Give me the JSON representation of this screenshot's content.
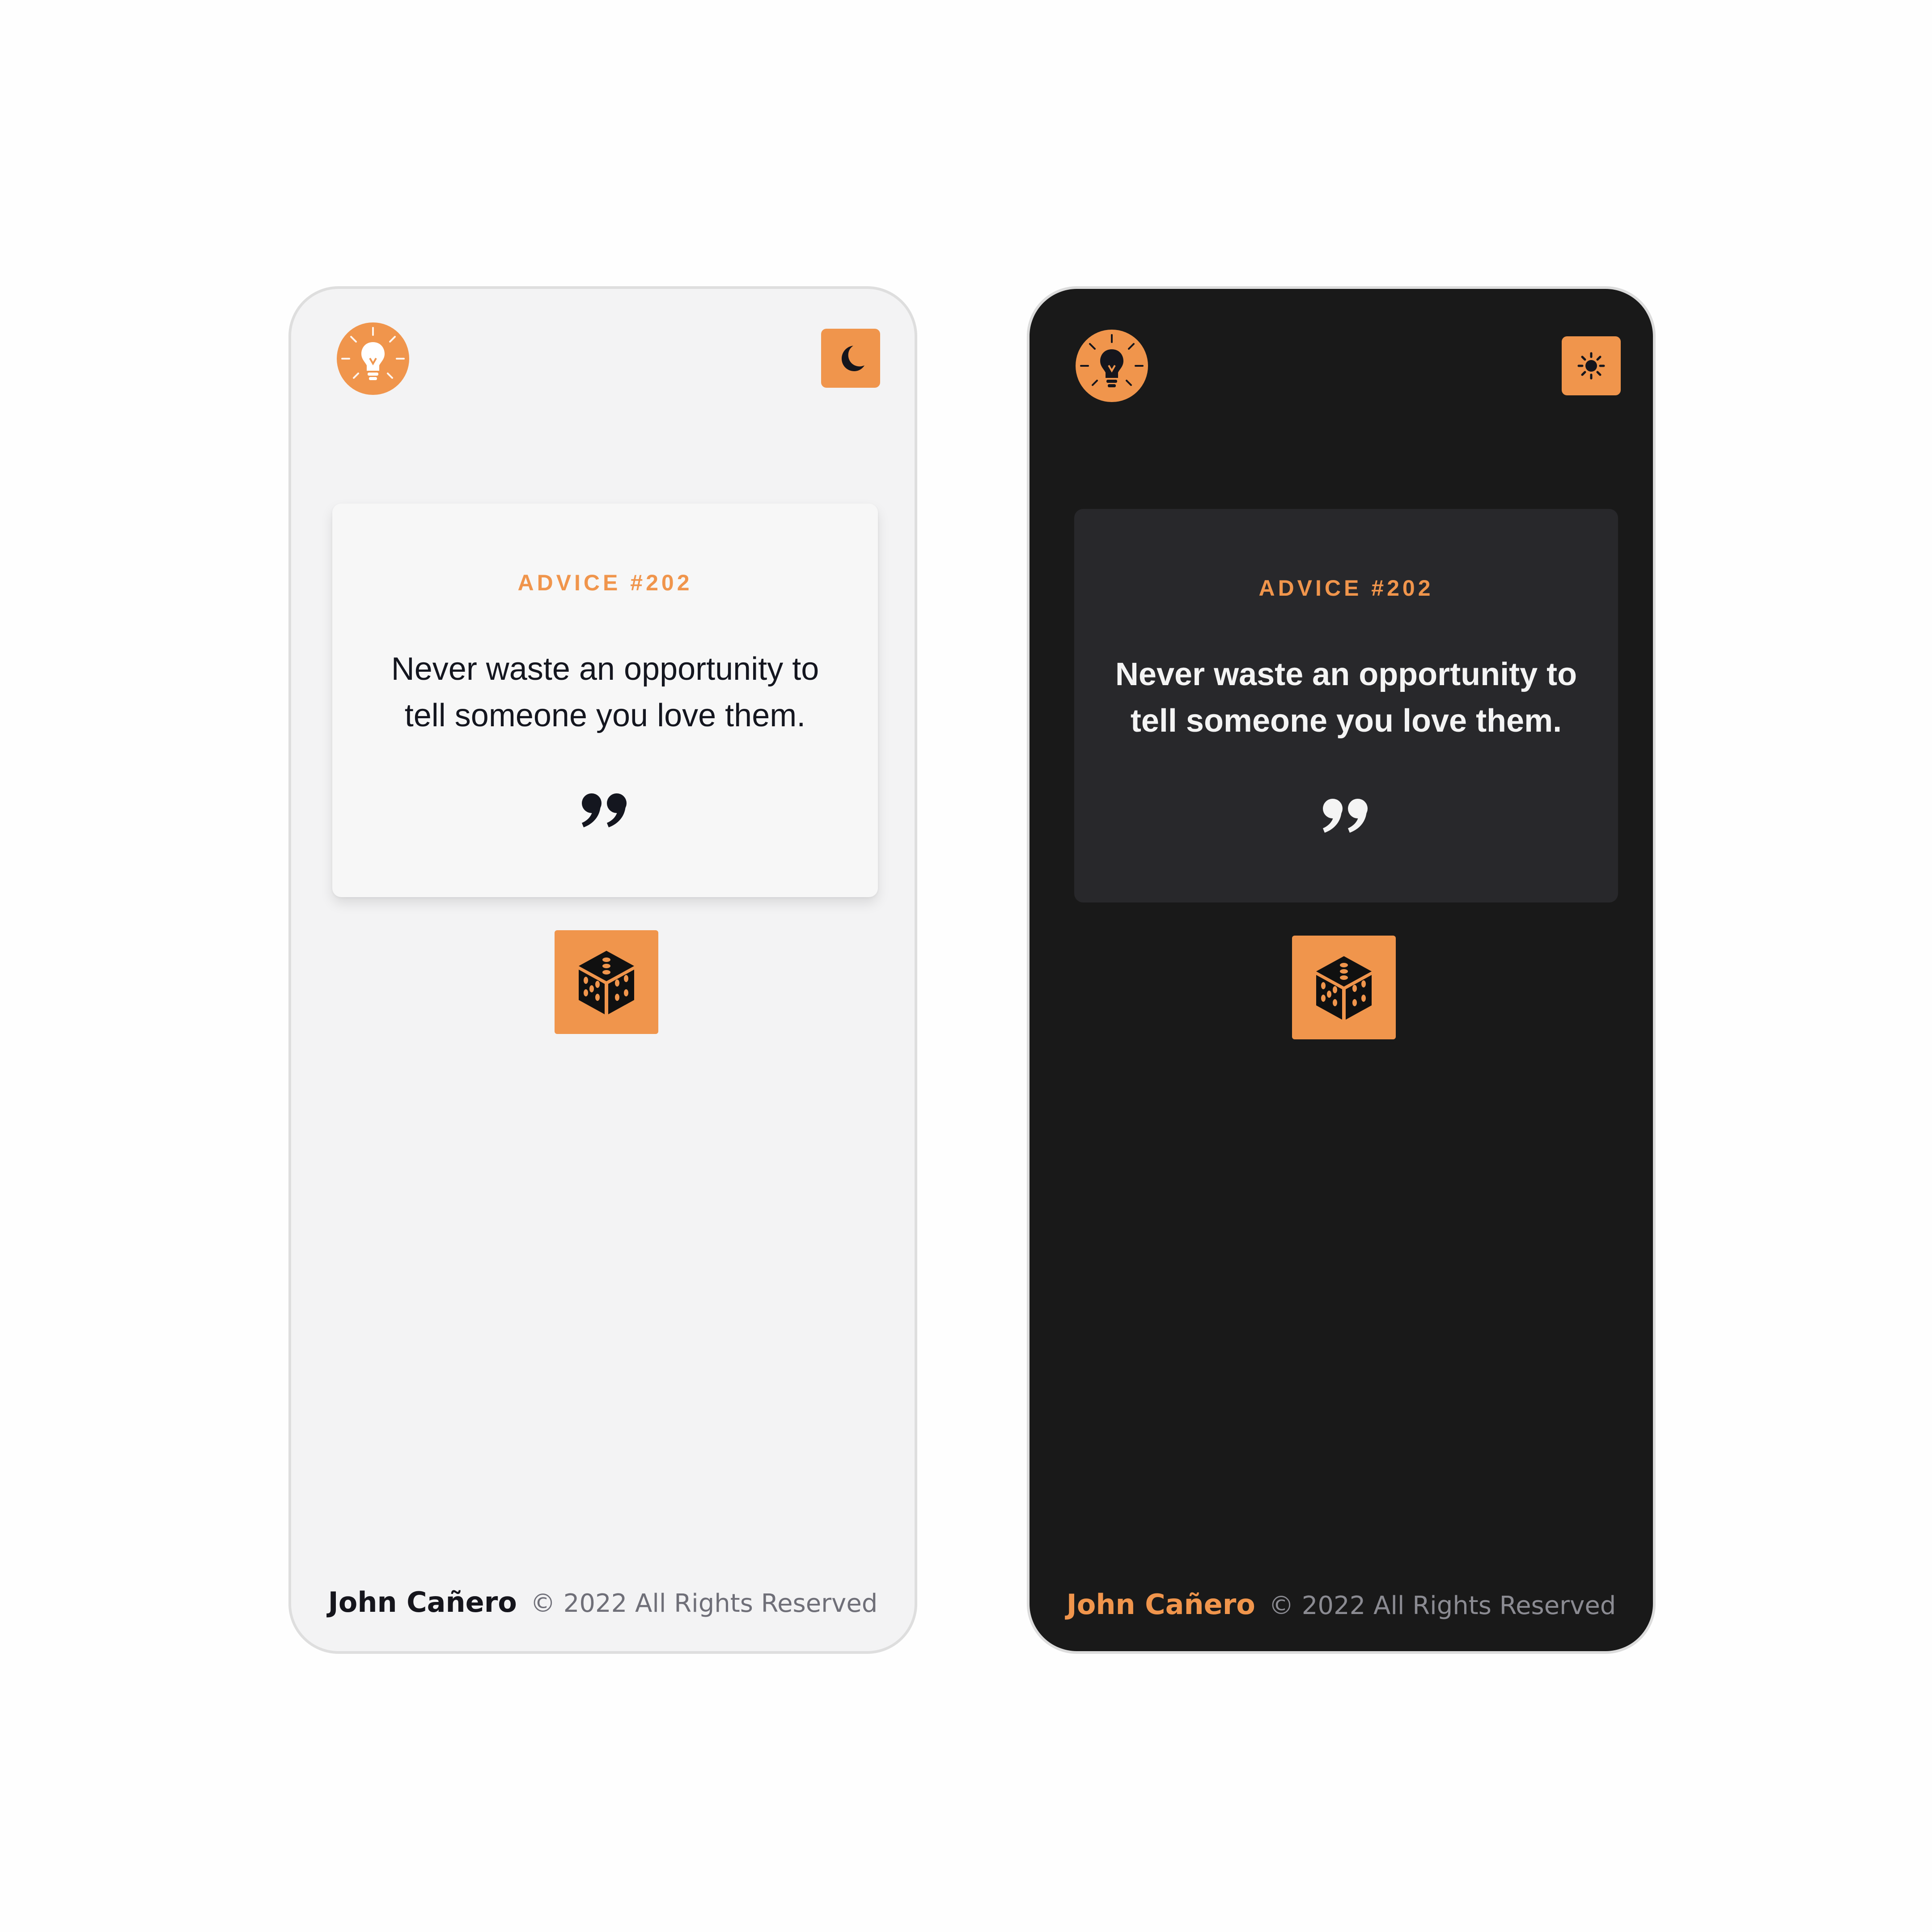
{
  "colors": {
    "accent": "#f0954c",
    "light_bg": "#f3f3f4",
    "light_card": "#f7f7f7",
    "dark_bg": "#191919",
    "dark_card": "#28282b",
    "light_text": "#14161f",
    "dark_text": "#f4f4f4"
  },
  "light": {
    "logo_icon": "lightbulb-icon",
    "toggle_icon": "moon-icon",
    "advice_id": "ADVICE #202",
    "advice_text": "Never waste an opportunity to tell someone you love them.",
    "quote_icon": "quote-icon",
    "dice_icon": "dice-icon",
    "footer_author": "John Cañero",
    "footer_copy": "© 2022 All Rights Reserved"
  },
  "dark": {
    "logo_icon": "lightbulb-icon",
    "toggle_icon": "sun-icon",
    "advice_id": "ADVICE #202",
    "advice_text": "Never waste an opportunity to tell someone you love them.",
    "quote_icon": "quote-icon",
    "dice_icon": "dice-icon",
    "footer_author": "John Cañero",
    "footer_copy": "© 2022 All Rights Reserved"
  }
}
